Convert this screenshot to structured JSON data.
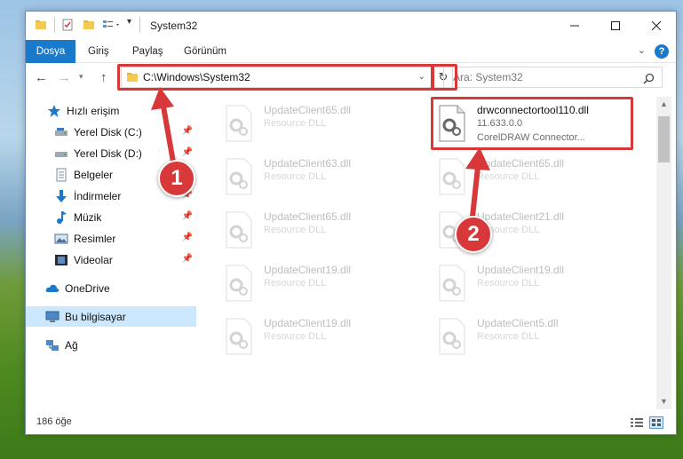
{
  "window": {
    "title": "System32"
  },
  "ribbon": {
    "tabs": [
      "Dosya",
      "Giriş",
      "Paylaş",
      "Görünüm"
    ]
  },
  "nav": {
    "address": "C:\\Windows\\System32",
    "search_placeholder": "Ara: System32"
  },
  "sidebar": {
    "items": [
      {
        "label": "Hızlı erişim",
        "icon": "star-icon",
        "pinned": false
      },
      {
        "label": "Yerel Disk (C:)",
        "icon": "drive-icon",
        "pinned": true
      },
      {
        "label": "Yerel Disk (D:)",
        "icon": "drive-icon",
        "pinned": true
      },
      {
        "label": "Belgeler",
        "icon": "documents-icon",
        "pinned": true
      },
      {
        "label": "İndirmeler",
        "icon": "download-icon",
        "pinned": true
      },
      {
        "label": "Müzik",
        "icon": "music-icon",
        "pinned": true
      },
      {
        "label": "Resimler",
        "icon": "pictures-icon",
        "pinned": true
      },
      {
        "label": "Videolar",
        "icon": "videos-icon",
        "pinned": true
      },
      {
        "label": "OneDrive",
        "icon": "cloud-icon",
        "pinned": false
      },
      {
        "label": "Bu bilgisayar",
        "icon": "computer-icon",
        "pinned": false,
        "selected": true
      },
      {
        "label": "Ağ",
        "icon": "network-icon",
        "pinned": false
      }
    ]
  },
  "files": {
    "left": [
      {
        "name": "UpdateClient65.dll",
        "type": "Resource DLL"
      },
      {
        "name": "UpdateClient63.dll",
        "type": "Resource DLL"
      },
      {
        "name": "UpdateClient65.dll",
        "type": "Resource DLL"
      },
      {
        "name": "UpdateClient19.dll",
        "type": "Resource DLL"
      },
      {
        "name": "UpdateClient19.dll",
        "type": "Resource DLL"
      }
    ],
    "right": [
      {
        "name": "drwconnectortool110.dll",
        "version": "11.633.0.0",
        "type": "CorelDRAW Connector..."
      },
      {
        "name": "UpdateClient65.dll",
        "type": "Resource DLL"
      },
      {
        "name": "UpdateClient21.dll",
        "type": "Resource DLL"
      },
      {
        "name": "UpdateClient19.dll",
        "type": "Resource DLL"
      },
      {
        "name": "UpdateClient5.dll",
        "type": "Resource DLL"
      }
    ]
  },
  "status": {
    "item_count": "186 öğe"
  },
  "callouts": [
    "1",
    "2"
  ],
  "colors": {
    "accent": "#1979ca",
    "highlight": "#d9383a",
    "selection": "#cce8ff"
  }
}
